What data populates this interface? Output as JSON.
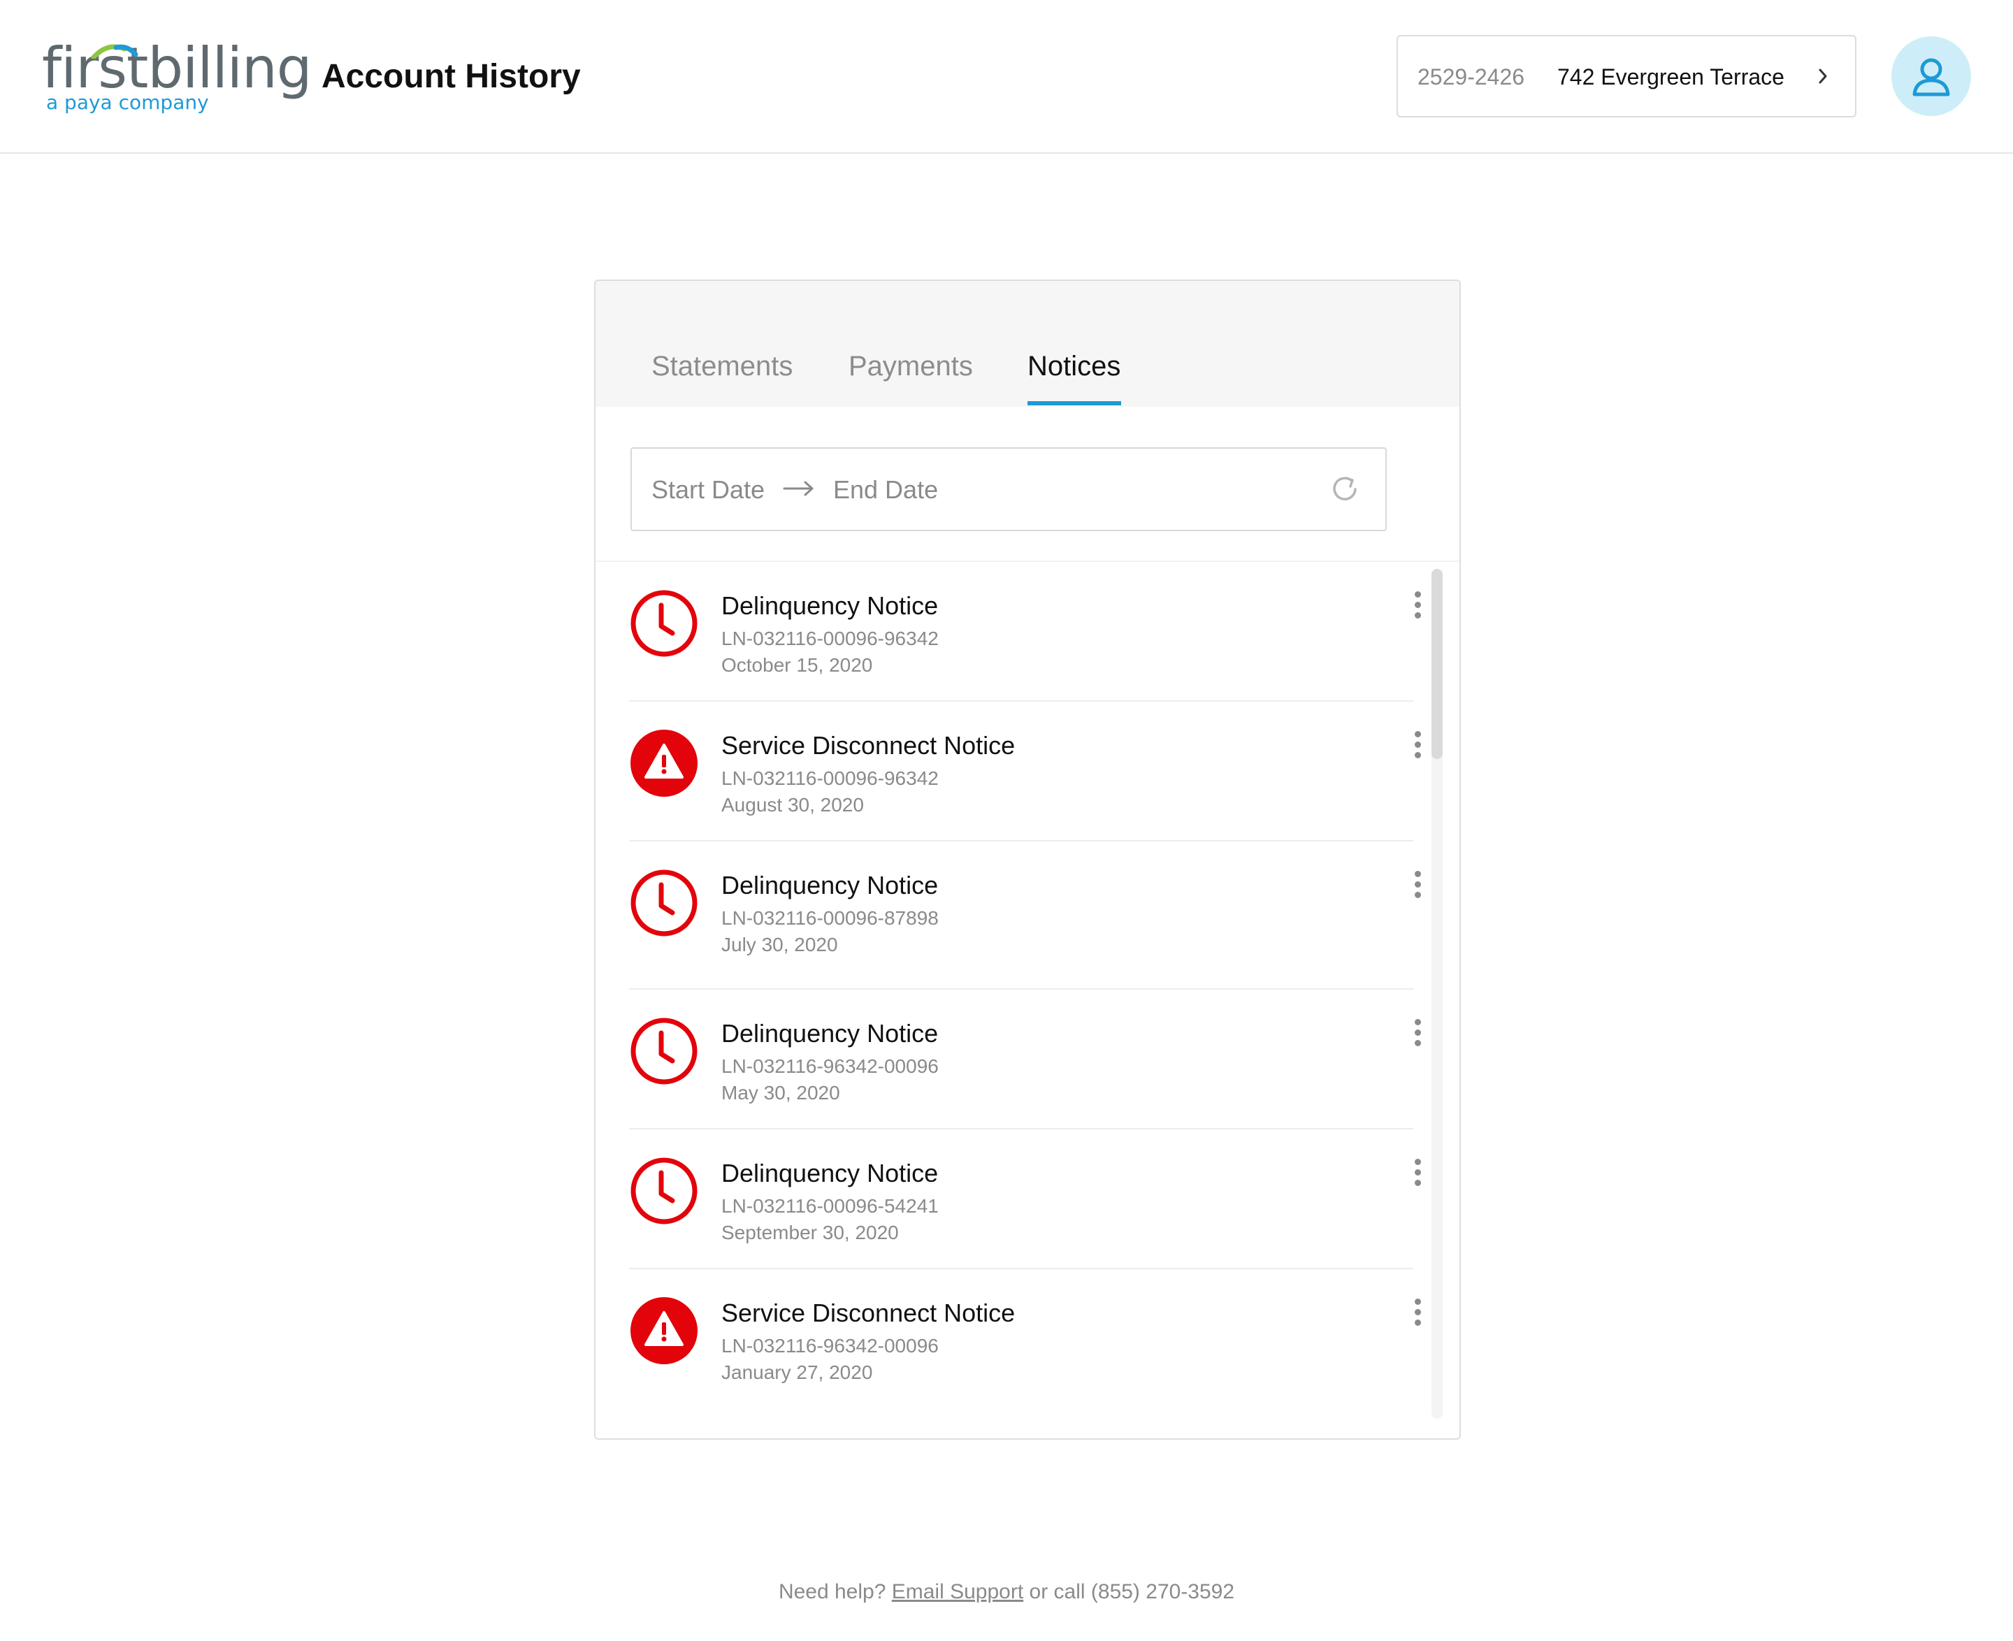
{
  "header": {
    "logo_main": "firstbilling",
    "logo_sub": "a paya company",
    "title": "Account History",
    "account_number": "2529-2426",
    "account_address": "742 Evergreen Terrace"
  },
  "tabs": [
    {
      "label": "Statements",
      "active": false
    },
    {
      "label": "Payments",
      "active": false
    },
    {
      "label": "Notices",
      "active": true
    }
  ],
  "date_filter": {
    "start_placeholder": "Start Date",
    "end_placeholder": "End Date"
  },
  "notices": [
    {
      "icon": "clock-icon",
      "title": "Delinquency Notice",
      "ref": "LN-032116-00096-96342",
      "date": "October 15, 2020"
    },
    {
      "icon": "warning-icon",
      "title": "Service Disconnect Notice",
      "ref": "LN-032116-00096-96342",
      "date": "August 30, 2020"
    },
    {
      "icon": "clock-icon",
      "title": "Delinquency Notice",
      "ref": "LN-032116-00096-87898",
      "date": "July 30, 2020"
    },
    {
      "icon": "clock-icon",
      "title": "Delinquency Notice",
      "ref": "LN-032116-96342-00096",
      "date": "May 30, 2020"
    },
    {
      "icon": "clock-icon",
      "title": "Delinquency Notice",
      "ref": "LN-032116-00096-54241",
      "date": "September 30, 2020"
    },
    {
      "icon": "warning-icon",
      "title": "Service Disconnect Notice",
      "ref": "LN-032116-96342-00096",
      "date": "January 27, 2020"
    }
  ],
  "footer": {
    "prefix": "Need help?",
    "link": "Email Support",
    "suffix": "or call (855) 270-3592"
  },
  "colors": {
    "accent": "#1e9ad6",
    "alert": "#e3040b",
    "avatar_bg": "#cdeef8"
  }
}
